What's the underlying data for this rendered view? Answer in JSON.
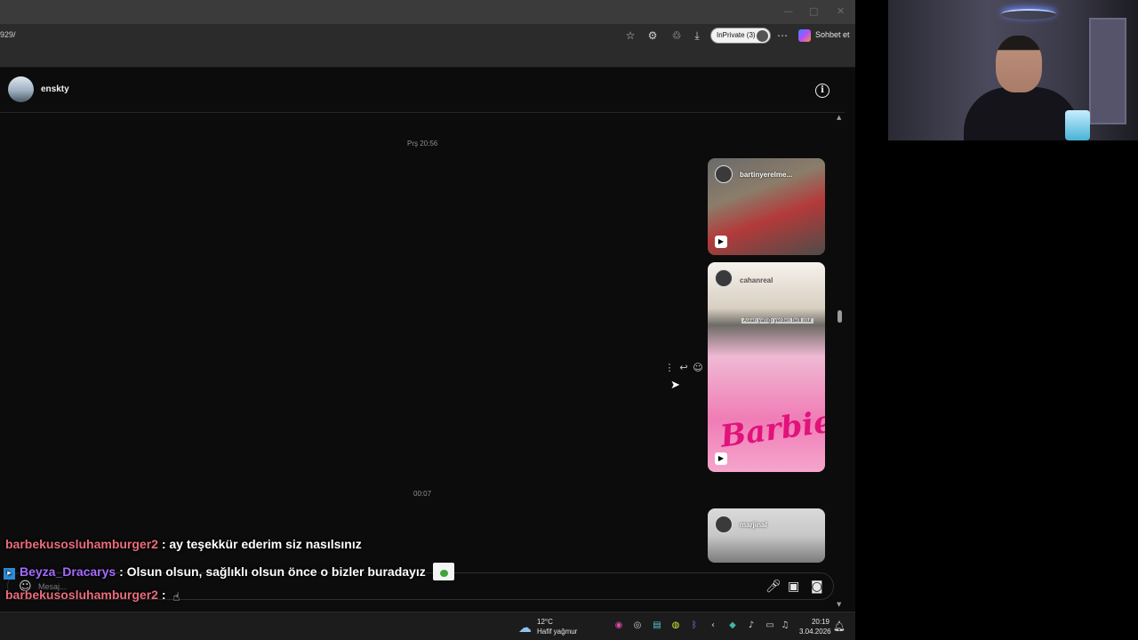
{
  "browser": {
    "url": "929/",
    "inprivate_label": "InPrivate (3)",
    "chat_label": "Sohbet et",
    "window_controls": [
      "—",
      "□",
      "✕"
    ]
  },
  "chat": {
    "username": "enskty",
    "timestamps": [
      "Prş 20:56",
      "00:07"
    ],
    "reels": [
      {
        "user": "bartinyerelme..."
      },
      {
        "user": "cahanreal",
        "caption": "Aslan yattığı yerden belli olur",
        "overlay_text": "Barbie"
      },
      {
        "user": "marjinal"
      }
    ],
    "composer_placeholder": "Mesaj..."
  },
  "overlay_chat": [
    {
      "name": "barbekusosluhamburger2",
      "sep": ":",
      "text": "ay teşekkür ederim siz nasılsınız"
    },
    {
      "name": "Beyza_Dracarys",
      "sep": ":",
      "text": "Olsun olsun, sağlıklı olsun önce o bizler buradayız"
    },
    {
      "name": "barbekusosluhamburger2",
      "sep": ":",
      "text": ""
    }
  ],
  "taskbar": {
    "temperature": "12°C",
    "weather": "Hafif yağmur",
    "time": "20:19",
    "date": "3.04.2026"
  },
  "colors": {
    "page_bg": "#0c0c0c",
    "name_pink": "#ea6d7b",
    "name_purple": "#a56bff"
  }
}
